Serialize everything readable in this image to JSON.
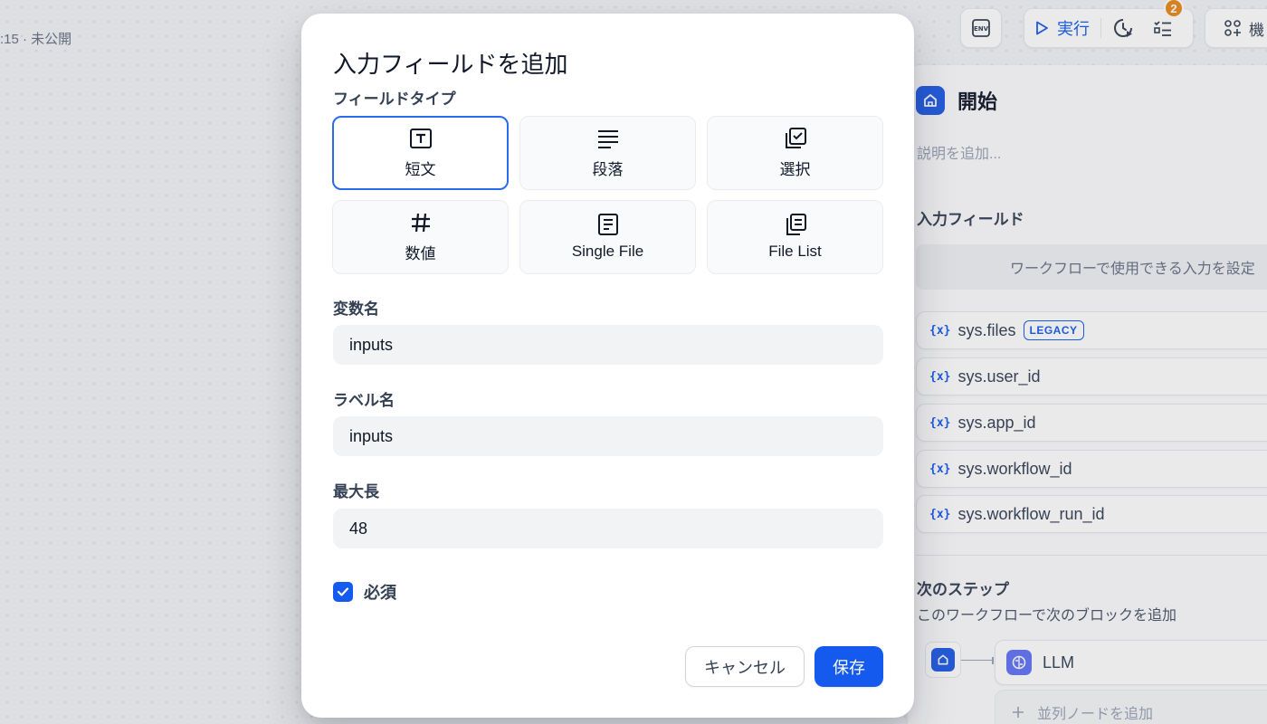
{
  "background": {
    "status_text": ":15 · 未公開"
  },
  "toolbar": {
    "env_icon": "env-icon",
    "run_label": "実行",
    "checklist_badge": "2",
    "features_label": "機"
  },
  "panel": {
    "title": "開始",
    "description_placeholder": "説明を追加...",
    "input_fields_title": "入力フィールド",
    "input_hint": "ワークフローで使用できる入力を設定",
    "sys_vars": [
      {
        "name": "sys.files",
        "badge": "LEGACY"
      },
      {
        "name": "sys.user_id"
      },
      {
        "name": "sys.app_id"
      },
      {
        "name": "sys.workflow_id"
      },
      {
        "name": "sys.workflow_run_id"
      }
    ],
    "var_icon_text": "{x}",
    "next_step_title": "次のステップ",
    "next_step_subtitle": "このワークフローで次のブロックを追加",
    "next_node_label": "LLM",
    "add_parallel_label": "並列ノードを追加"
  },
  "modal": {
    "title": "入力フィールドを追加",
    "field_type_label": "フィールドタイプ",
    "field_types": [
      {
        "label": "短文",
        "icon": "text-box-icon",
        "selected": true
      },
      {
        "label": "段落",
        "icon": "paragraph-lines-icon",
        "selected": false
      },
      {
        "label": "選択",
        "icon": "multi-check-icon",
        "selected": false
      },
      {
        "label": "数値",
        "icon": "hash-icon",
        "selected": false
      },
      {
        "label": "Single File",
        "icon": "file-icon",
        "selected": false
      },
      {
        "label": "File List",
        "icon": "file-stack-icon",
        "selected": false
      }
    ],
    "variable_name_label": "変数名",
    "variable_name_value": "inputs",
    "label_name_label": "ラベル名",
    "label_name_value": "inputs",
    "max_length_label": "最大長",
    "max_length_value": "48",
    "required_label": "必須",
    "required_checked": true,
    "cancel_label": "キャンセル",
    "save_label": "保存"
  },
  "colors": {
    "accent": "#155aef",
    "badge": "#e88a1a",
    "start_icon": "#1f5ce6",
    "llm_icon": "#6172f3"
  }
}
